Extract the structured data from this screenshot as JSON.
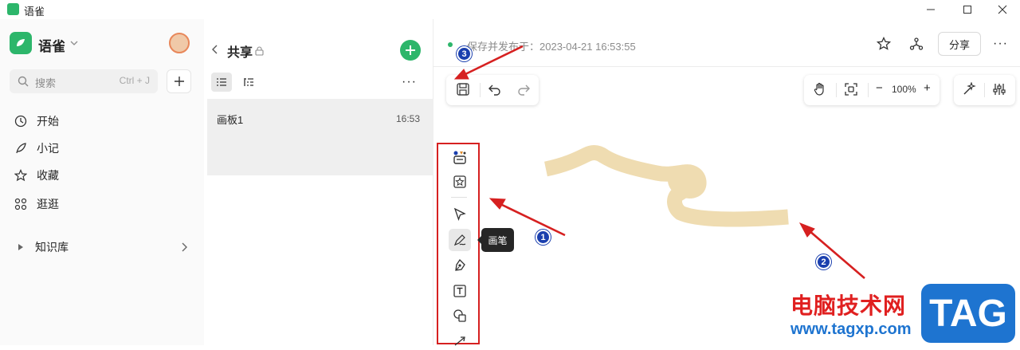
{
  "window": {
    "title": "语雀"
  },
  "sidebar": {
    "brand": "语雀",
    "search": {
      "placeholder": "搜索",
      "shortcut": "Ctrl + J"
    },
    "nav": [
      {
        "label": "开始",
        "icon": "clock-icon"
      },
      {
        "label": "小记",
        "icon": "feather-icon"
      },
      {
        "label": "收藏",
        "icon": "star-icon"
      },
      {
        "label": "逛逛",
        "icon": "grid-dots-icon"
      }
    ],
    "knowledge_base": "知识库"
  },
  "doc_list": {
    "title": "共享",
    "docs": [
      {
        "name": "画板1",
        "time": "16:53"
      }
    ]
  },
  "editor": {
    "save_status": "保存并发布于：2023-04-21 16:53:55",
    "share_label": "分享",
    "zoom": "100%",
    "tooltip": "画笔",
    "stroke_color": "#efdcb1"
  },
  "annotations": {
    "marker_1": "1",
    "marker_2": "2",
    "marker_3": "3"
  },
  "watermark": {
    "site_cn": "电脑技术网",
    "url": "www.tagxp.com",
    "tag": "TAG"
  }
}
